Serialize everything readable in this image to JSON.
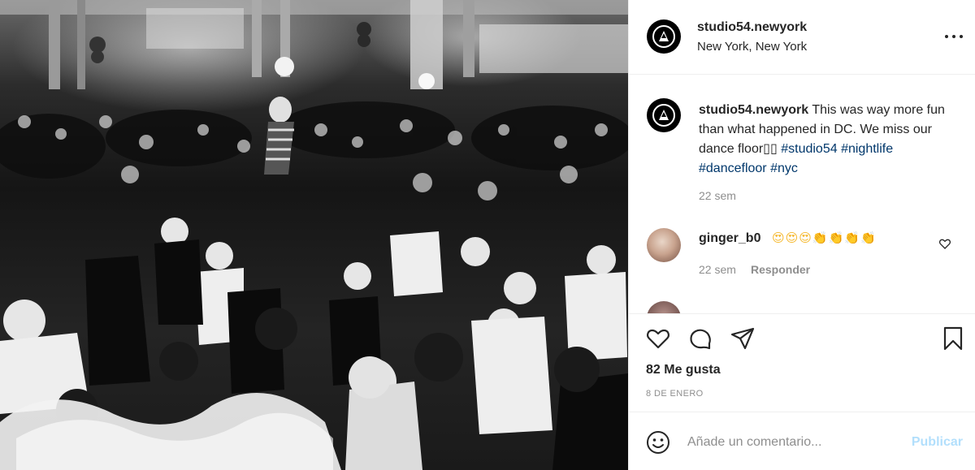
{
  "post": {
    "photo_description": "",
    "username": "studio54.newyork",
    "location": "New York, New York",
    "more_options_icon": "ellipsis-icon"
  },
  "caption": {
    "username": "studio54.newyork",
    "text": " This was way more fun than what happened in DC. We miss our dance floor▯▯",
    "hashtags": [
      "#studio54",
      "#nightlife",
      "#dancefloor",
      "#nyc"
    ],
    "time": "22 sem"
  },
  "comments": [
    {
      "username": "ginger_b0",
      "text": "😍😍😍👏👏👏👏",
      "time": "22 sem",
      "reply_label": "Responder"
    }
  ],
  "actions": {
    "icons": [
      "heart-icon",
      "comment-icon",
      "share-icon",
      "bookmark-icon"
    ],
    "likes": "82 Me gusta",
    "date": "8 DE ENERO"
  },
  "add_comment": {
    "placeholder": "Añade un comentario...",
    "post_label": "Publicar",
    "post_color": "#b2dffc"
  },
  "colors": {
    "hashtag": "#00376b",
    "secondary_text": "#8e8e8e",
    "divider": "#efefef"
  }
}
